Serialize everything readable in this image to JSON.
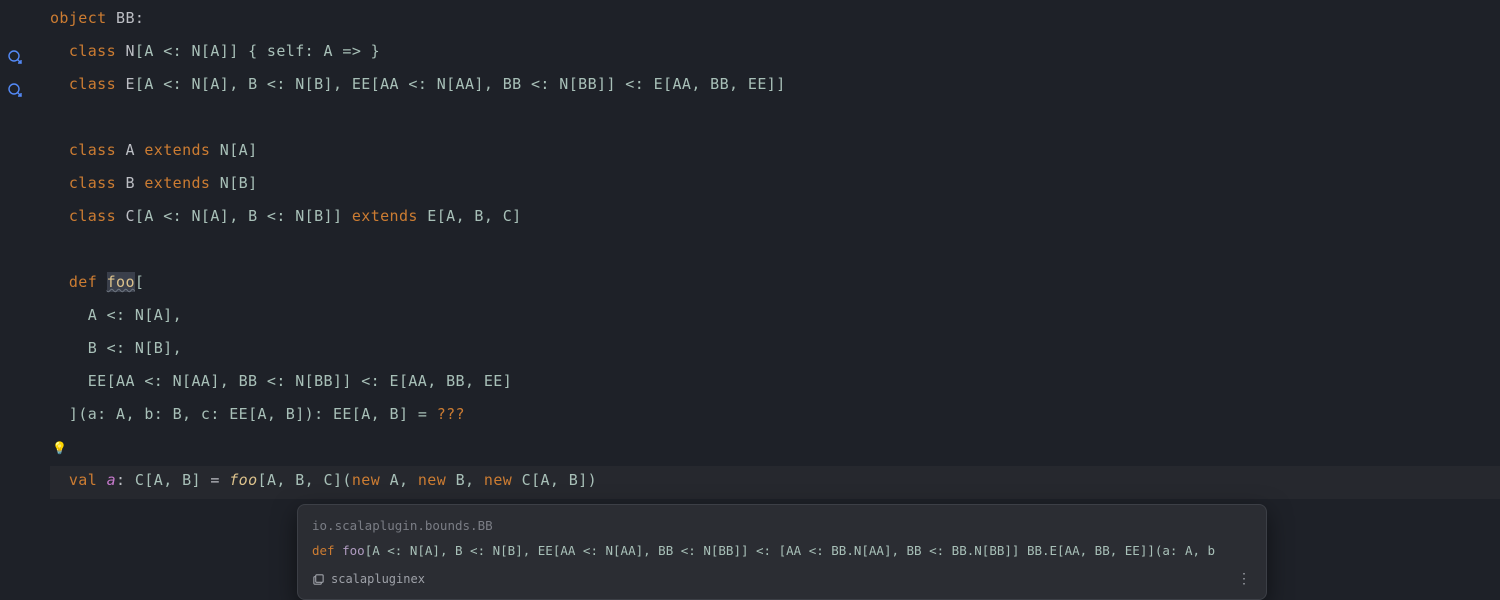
{
  "code": {
    "l1": {
      "object": "object",
      "name": "BB",
      "colon": ":"
    },
    "l2": {
      "class": "class",
      "name": "N",
      "sig": "[A <: N[A]] { self: A => }"
    },
    "l3": {
      "class": "class",
      "name": "E",
      "sig": "[A <: N[A], B <: N[B], EE[AA <: N[AA], BB <: N[BB]] <: E[AA, BB, EE]]"
    },
    "l5": {
      "class": "class",
      "name": "A",
      "extends": "extends",
      "sup": "N[A]"
    },
    "l6": {
      "class": "class",
      "name": "B",
      "extends": "extends",
      "sup": "N[B]"
    },
    "l7": {
      "class": "class",
      "name": "C",
      "sig": "[A <: N[A], B <: N[B]]",
      "extends": "extends",
      "sup": "E[A, B, C]"
    },
    "l9": {
      "def": "def",
      "name": "foo",
      "open": "["
    },
    "l10": "A <: N[A],",
    "l11": "B <: N[B],",
    "l12": "EE[AA <: N[AA], BB <: N[BB]] <: E[AA, BB, EE]",
    "l13": {
      "close": "]",
      "params": "(a: A, b: B, c: EE[A, B]): EE[A, B] = ",
      "qqq": "???"
    },
    "l15": {
      "val": "val",
      "name": "a",
      "colon": ": ",
      "type": "C[A, B]",
      "eq": " = ",
      "fn": "foo",
      "args1": "[A, B, C](",
      "new1": "new",
      "a1": " A, ",
      "new2": "new",
      "a2": " B, ",
      "new3": "new",
      "a3": " C[A, B])"
    }
  },
  "popup": {
    "path": "io.scalaplugin.bounds.BB",
    "sig_def": "def",
    "sig_fn": "foo",
    "sig_rest": "[A <: N[A], B <: N[B], EE[AA <: N[AA], BB <: N[BB]] <: [AA <: BB.N[AA], BB <: BB.N[BB]] BB.E[AA, BB, EE]](a: A, b",
    "module": "scalapluginex"
  }
}
